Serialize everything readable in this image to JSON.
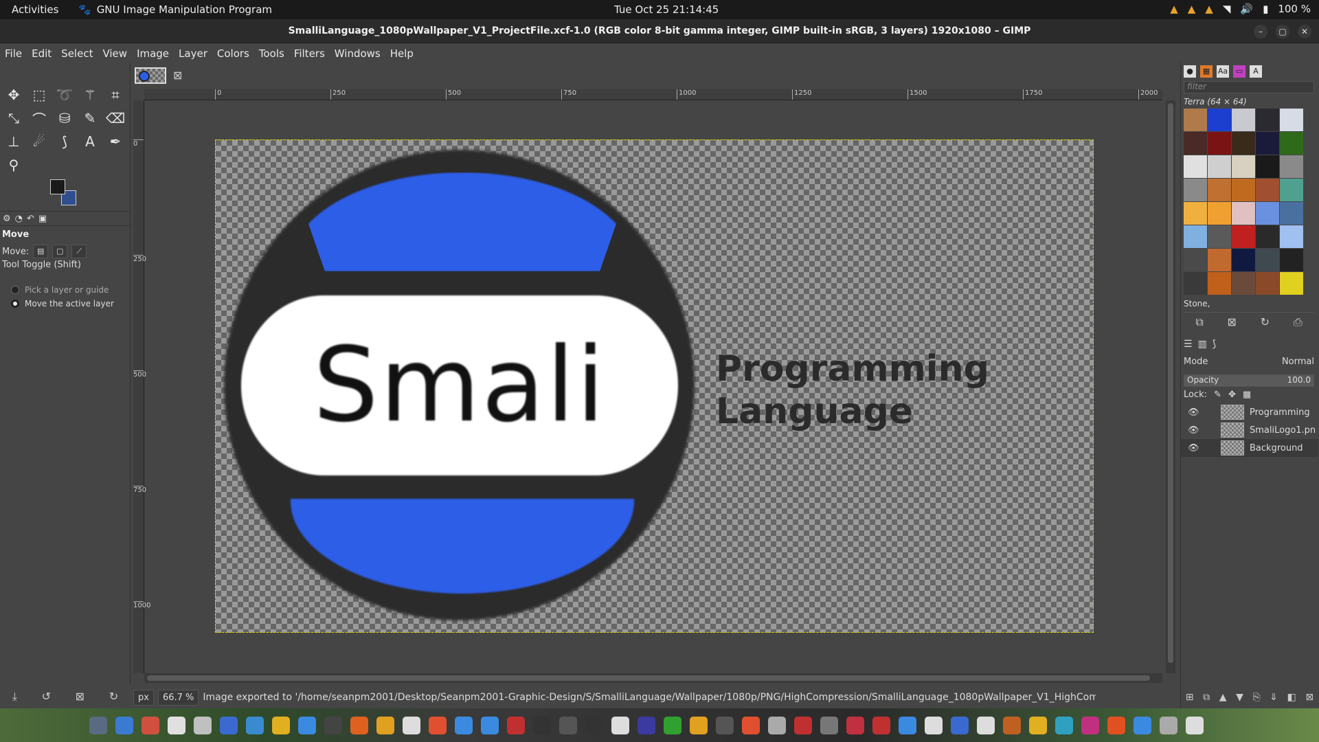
{
  "topbar": {
    "activities": "Activities",
    "app_name": "GNU Image Manipulation Program",
    "clock": "Tue Oct 25  21:14:45",
    "battery": "100 %"
  },
  "window": {
    "title": "SmalliLanguage_1080pWallpaper_V1_ProjectFile.xcf-1.0 (RGB color 8-bit gamma integer, GIMP built-in sRGB, 3 layers) 1920x1080 – GIMP"
  },
  "menu": [
    "File",
    "Edit",
    "Select",
    "View",
    "Image",
    "Layer",
    "Colors",
    "Tools",
    "Filters",
    "Windows",
    "Help"
  ],
  "ruler": {
    "top": [
      "0",
      "250",
      "500",
      "750",
      "1000",
      "1250",
      "1500",
      "1750",
      "2000"
    ],
    "left": [
      "0",
      "250",
      "500",
      "750",
      "1000"
    ]
  },
  "tool_options": {
    "title": "Move",
    "move_label": "Move:",
    "toggle_label": "Tool Toggle  (Shift)",
    "option1": "Pick a layer or guide",
    "option2": "Move the active layer"
  },
  "canvas": {
    "logo_text": "Smali",
    "line1": "Programming",
    "line2": "Language"
  },
  "status": {
    "unit": "px",
    "zoom": "66.7 %",
    "message": "Image exported to '/home/seanpm2001/Desktop/Seanpm2001-Graphic-Design/S/SmalliLanguage/Wallpaper/1080p/PNG/HighCompression/SmalliLanguage_1080pWallpaper_V1_HighComp..."
  },
  "patterns": {
    "filter_placeholder": "filter",
    "current": "Terra (64 × 64)",
    "selected": "Stone,",
    "colors": [
      "#b07a4a",
      "#1d3fcf",
      "#c9c9d0",
      "#2a2a30",
      "#d6dbe6",
      "#4a2a26",
      "#7a1414",
      "#3a2a1a",
      "#1a1a3a",
      "#2f6a1a",
      "#e0e0e0",
      "#cfcfcf",
      "#d8d0c0",
      "#1a1a1a",
      "#8a8a8a",
      "#8a8a8a",
      "#c07030",
      "#c06a20",
      "#a05030",
      "#50a090",
      "#f0b040",
      "#f0a030",
      "#e0c0c0",
      "#6a90e0",
      "#4a70a0",
      "#80b0e0",
      "#5a5a5a",
      "#c02020",
      "#2a2a2a",
      "#a0c0f0",
      "#4a4a4a",
      "#c06a30",
      "#101a40",
      "#404850",
      "#222222",
      "#3a3a3a",
      "#c0601a",
      "#6a4a3a",
      "#8a4a2a",
      "#e0d020"
    ]
  },
  "layers_panel": {
    "mode_label": "Mode",
    "mode_value": "Normal",
    "opacity_label": "Opacity",
    "opacity_value": "100.0",
    "lock_label": "Lock:",
    "layers": [
      "Programming",
      "SmaliLogo1.pn",
      "Background"
    ]
  },
  "colors": {
    "accent_blue": "#2d5ee8",
    "fg_color": "#1a1a1a",
    "bg_color": "#2f4f8f"
  }
}
